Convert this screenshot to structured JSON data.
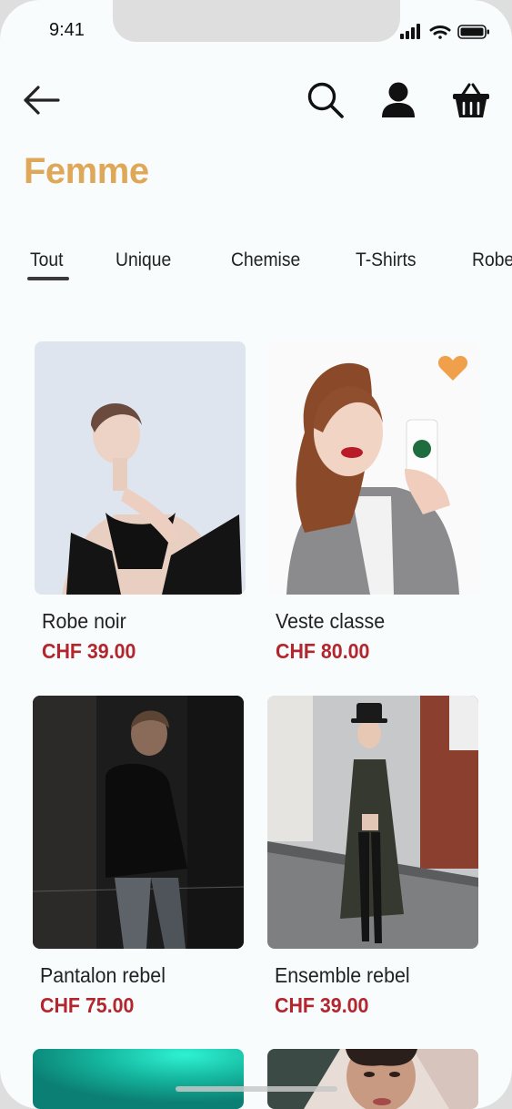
{
  "status": {
    "time": "9:41"
  },
  "header": {
    "title": "Femme"
  },
  "tabs": [
    {
      "label": "Tout",
      "active": true
    },
    {
      "label": "Unique",
      "active": false
    },
    {
      "label": "Chemise",
      "active": false
    },
    {
      "label": "T-Shirts",
      "active": false
    },
    {
      "label": "Robe",
      "active": false
    }
  ],
  "products": [
    {
      "name": "Robe noir",
      "price": "CHF 39.00",
      "favorite": false
    },
    {
      "name": "Veste classe",
      "price": "CHF 80.00",
      "favorite": true
    },
    {
      "name": "Pantalon rebel",
      "price": "CHF 75.00",
      "favorite": false
    },
    {
      "name": "Ensemble rebel",
      "price": "CHF 39.00",
      "favorite": false
    }
  ],
  "colors": {
    "accent": "#dfa758",
    "price": "#b3262e",
    "favorite": "#f0a04b"
  }
}
